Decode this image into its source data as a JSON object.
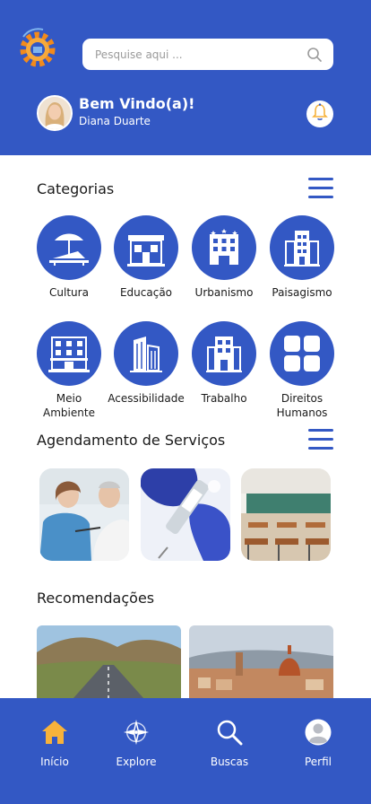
{
  "search": {
    "placeholder": "Pesquise aqui ..."
  },
  "user": {
    "greeting": "Bem Vindo(a)!",
    "name": "Diana Duarte"
  },
  "sections": {
    "categories": "Categorias",
    "services": "Agendamento de Serviços",
    "recommendations": "Recomendações"
  },
  "categories": [
    {
      "label": "Cultura",
      "icon": "beach-chair-icon"
    },
    {
      "label": "Educação",
      "icon": "school-building-icon"
    },
    {
      "label": "Urbanismo",
      "icon": "city-hall-icon"
    },
    {
      "label": "Paisagismo",
      "icon": "tower-building-icon"
    },
    {
      "label": "Meio\nAmbiente",
      "icon": "residential-building-icon"
    },
    {
      "label": "Acessibilidade",
      "icon": "skyscraper-icon"
    },
    {
      "label": "Trabalho",
      "icon": "office-building-icon"
    },
    {
      "label": "Direitos\nHumanos",
      "icon": "grid-icon"
    }
  ],
  "nav": [
    {
      "label": "Início",
      "icon": "home-icon",
      "active": true
    },
    {
      "label": "Explore",
      "icon": "compass-icon"
    },
    {
      "label": "Buscas",
      "icon": "search-icon"
    },
    {
      "label": "Perfil",
      "icon": "user-icon"
    }
  ],
  "colors": {
    "primary": "#3358c4",
    "accent": "#f7b23b"
  }
}
